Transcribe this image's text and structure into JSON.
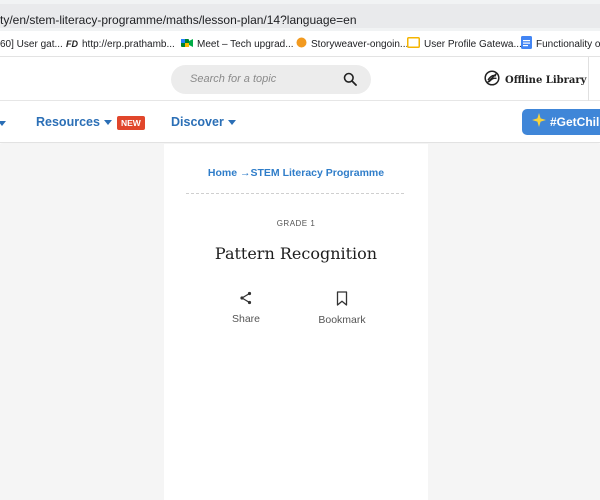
{
  "browser": {
    "url": "ty/en/stem-literacy-programme/maths/lesson-plan/14?language=en",
    "bookmarks": [
      {
        "label": "60] User gat...",
        "icon": "tab-icon"
      },
      {
        "label": "http://erp.prathamb...",
        "icon": "fd-logo-icon"
      },
      {
        "label": "Meet – Tech upgrad...",
        "icon": "meet-icon"
      },
      {
        "label": "Storyweaver-ongoin...",
        "icon": "orange-dot-icon"
      },
      {
        "label": "User Profile Gatewa...",
        "icon": "folder-icon"
      },
      {
        "label": "Functionality of",
        "icon": "doc-icon"
      }
    ]
  },
  "header": {
    "search_placeholder": "Search for a topic",
    "offline_library": "Offline Library"
  },
  "nav": {
    "items": [
      {
        "label": "Resources"
      },
      {
        "label": "Discover"
      }
    ],
    "new_badge": "NEW",
    "cta_label": "#GetChil"
  },
  "lesson": {
    "breadcrumb": "Home →STEM Literacy Programme",
    "grade": "GRADE 1",
    "title": "Pattern Recognition",
    "share_label": "Share",
    "bookmark_label": "Bookmark"
  },
  "colors": {
    "link_blue": "#2b6fb6",
    "cta_blue": "#3f86d8",
    "badge_red": "#e1462b",
    "panel_gray": "#f5f5f5"
  }
}
